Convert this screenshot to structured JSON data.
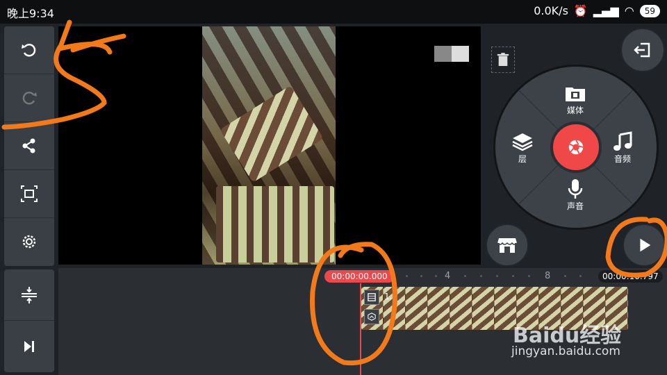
{
  "status_bar": {
    "time": "晚上9:34",
    "speed": "0.0K/s",
    "battery": "59"
  },
  "toolbar": {
    "items": [
      {
        "icon": "undo-icon"
      },
      {
        "icon": "redo-icon"
      },
      {
        "icon": "share-icon"
      },
      {
        "icon": "aspect-ratio-icon"
      },
      {
        "icon": "settings-icon"
      }
    ],
    "bottom_items": [
      {
        "icon": "track-height-icon"
      },
      {
        "icon": "skip-to-end-icon"
      }
    ]
  },
  "wheel": {
    "media_label": "媒体",
    "audio_label": "音频",
    "voice_label": "声音",
    "layer_label": "层"
  },
  "timeline": {
    "start_time": "00:00:00.000",
    "end_time": "00:00:10.797",
    "tick_4": "4",
    "tick_8": "8",
    "clip_label": "1."
  },
  "watermark": {
    "logo_text": "Baidu经验",
    "url": "jingyan.baidu.com"
  },
  "colors": {
    "accent_red": "#e8494d",
    "annotation_orange": "#f27a1a",
    "panel": "#3d4248"
  }
}
